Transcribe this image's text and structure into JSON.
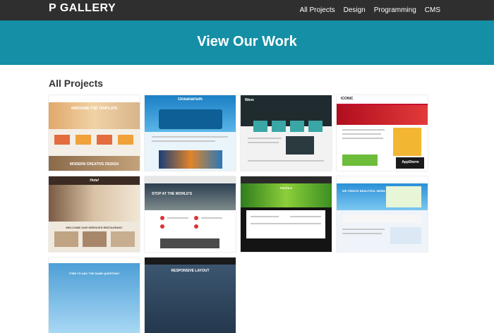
{
  "header": {
    "brand": "P GALLERY",
    "nav": [
      "All Projects",
      "Design",
      "Programming",
      "CMS"
    ]
  },
  "hero": {
    "title": "View Our Work"
  },
  "section": {
    "title": "All Projects"
  },
  "thumbnails": [
    {
      "caption": "AWESOME PSD TEMPLATE",
      "footer": "MODERN CREATIVE DESIGN"
    },
    {
      "caption": "Oceanarium"
    },
    {
      "caption": "Wave"
    },
    {
      "caption": "ICONIC",
      "badge": "AppStorm"
    },
    {
      "caption": "Hotel",
      "sub": "WELCOME   OUR SERVICES   RESTAURANT"
    },
    {
      "caption": "STOP AT THE WORLD'S"
    },
    {
      "caption": "PROFILE"
    },
    {
      "caption": "WE CREATE BEAUTIFUL WEBSITES"
    },
    {
      "caption": "\"FIRE TO ASK THE SAME QUESTION\""
    },
    {
      "caption": "RESPONSIVE LAYOUT"
    }
  ],
  "colors": {
    "topbar": "#2f2f2f",
    "hero": "#148fa6",
    "text": "#333333"
  }
}
